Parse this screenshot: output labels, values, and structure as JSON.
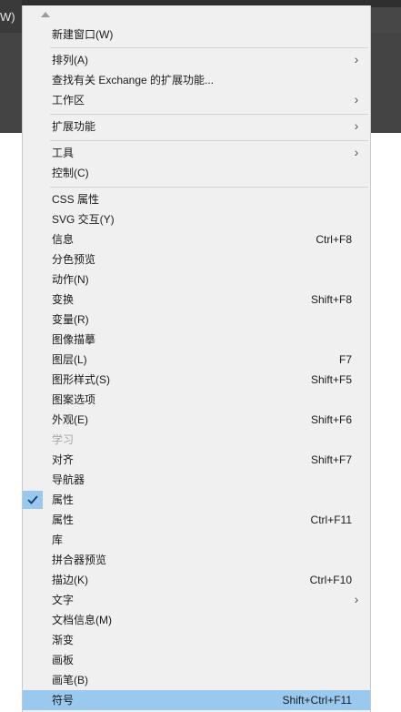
{
  "background": {
    "left_tab_text": "W)"
  },
  "menu": {
    "scroll_up_icon": "triangle-up",
    "items": [
      {
        "label": "新建窗口(W)",
        "shortcut": ""
      },
      {
        "label": "排列(A)",
        "submenu": true
      },
      {
        "label": "查找有关 Exchange 的扩展功能..."
      },
      {
        "label": "工作区",
        "submenu": true
      },
      {
        "label": "扩展功能",
        "submenu": true
      },
      {
        "label": "工具",
        "submenu": true
      },
      {
        "label": "控制(C)"
      },
      {
        "label": "CSS 属性"
      },
      {
        "label": "SVG 交互(Y)"
      },
      {
        "label": "信息",
        "shortcut": "Ctrl+F8"
      },
      {
        "label": "分色预览"
      },
      {
        "label": "动作(N)"
      },
      {
        "label": "变换",
        "shortcut": "Shift+F8"
      },
      {
        "label": "变量(R)"
      },
      {
        "label": "图像描摹"
      },
      {
        "label": "图层(L)",
        "shortcut": "F7"
      },
      {
        "label": "图形样式(S)",
        "shortcut": "Shift+F5"
      },
      {
        "label": "图案选项"
      },
      {
        "label": "外观(E)",
        "shortcut": "Shift+F6"
      },
      {
        "label": "学习",
        "disabled": true
      },
      {
        "label": "对齐",
        "shortcut": "Shift+F7"
      },
      {
        "label": "导航器"
      },
      {
        "label": "属性",
        "checked": true
      },
      {
        "label": "属性",
        "shortcut": "Ctrl+F11"
      },
      {
        "label": "库"
      },
      {
        "label": "拼合器预览"
      },
      {
        "label": "描边(K)",
        "shortcut": "Ctrl+F10"
      },
      {
        "label": "文字",
        "submenu": true
      },
      {
        "label": "文档信息(M)"
      },
      {
        "label": "渐变"
      },
      {
        "label": "画板"
      },
      {
        "label": "画笔(B)"
      },
      {
        "label": "符号",
        "shortcut": "Shift+Ctrl+F11",
        "highlighted": true
      }
    ]
  },
  "colors": {
    "menu_background": "#f0f0f0",
    "highlight": "#99c9ef",
    "separator": "#d3d3d3",
    "app_chrome": "#2f2f2f"
  }
}
